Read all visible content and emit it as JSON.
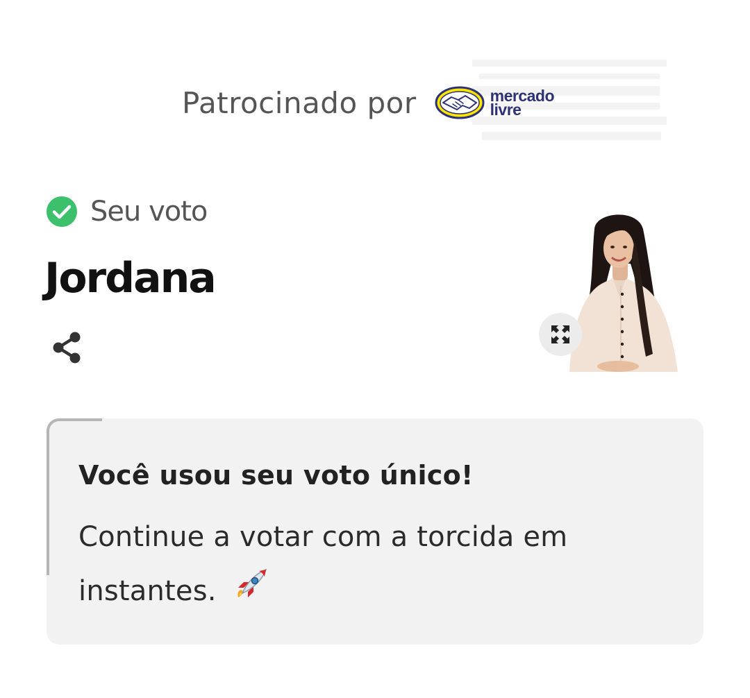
{
  "sponsor": {
    "label": "Patrocinado por",
    "logo_icon": "mercado-livre-handshake-logo",
    "logo_text_line1": "mercado",
    "logo_text_line2": "livre",
    "logo_colors": {
      "yellow": "#ffe600",
      "blue": "#2d3277"
    }
  },
  "vote": {
    "status_icon": "check-circle-icon",
    "status_color": "#3cc06b",
    "status_label": "Seu voto",
    "candidate_name": "Jordana",
    "share_icon": "share-icon",
    "expand_icon": "expand-icon"
  },
  "notice": {
    "title": "Você usou seu voto único!",
    "message": "Continue a votar com a torcida em instantes.",
    "emoji_icon": "rocket-icon"
  }
}
